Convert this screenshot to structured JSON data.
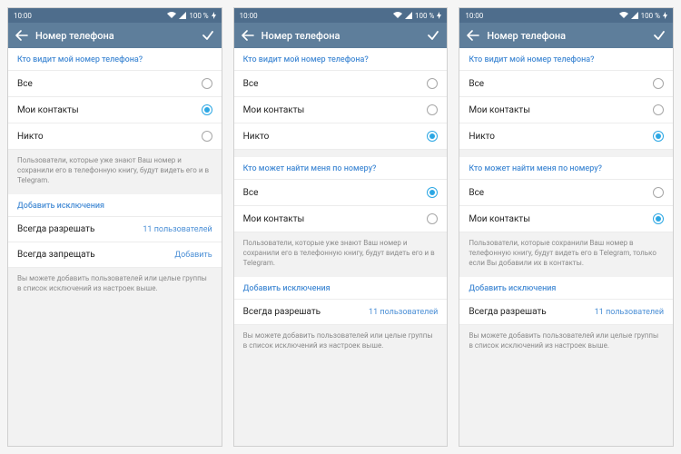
{
  "statusbar": {
    "time": "10:00",
    "battery": "100 %"
  },
  "titlebar": {
    "title": "Номер телефона"
  },
  "sections": {
    "who_sees": {
      "header": "Кто видит мой номер телефона?",
      "options": [
        "Все",
        "Мои контакты",
        "Никто"
      ]
    },
    "who_finds": {
      "header": "Кто может найти меня по номеру?",
      "options": [
        "Все",
        "Мои контакты"
      ]
    },
    "exceptions": {
      "header": "Добавить исключения",
      "always_allow": "Всегда разрешать",
      "always_deny": "Всегда запрещать",
      "count": "11 пользователей",
      "add": "Добавить"
    }
  },
  "notes": {
    "users_know": "Пользователи, которые уже знают Ваш номер и сохранили его в телефонную книгу, будут видеть его и в Telegram.",
    "users_saved": "Пользователи, которые сохранили Ваш номер в телефонную книгу, будут видеть его в Telegram, только если Вы добавили их в контакты.",
    "add_groups": "Вы можете добавить пользователей или целые группы в список исключений из настроек выше."
  },
  "screens": [
    {
      "who_sees_selected": 1,
      "show_who_finds": false,
      "find_selected": null,
      "note_after_options": "users_know",
      "show_always_deny": true
    },
    {
      "who_sees_selected": 2,
      "show_who_finds": true,
      "find_selected": 0,
      "note_after_options": "users_know",
      "show_always_deny": false
    },
    {
      "who_sees_selected": 2,
      "show_who_finds": true,
      "find_selected": 1,
      "note_after_options": "users_saved",
      "show_always_deny": false
    }
  ]
}
